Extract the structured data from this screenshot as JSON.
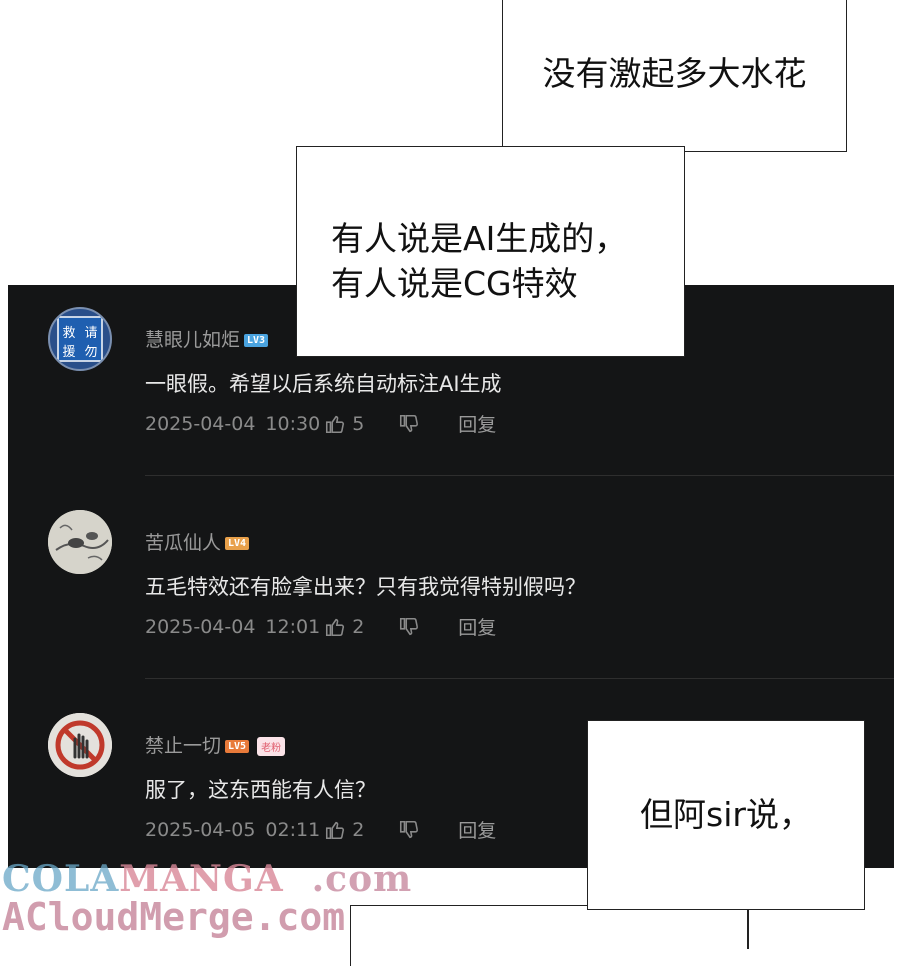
{
  "bubbles": {
    "top": "没有激起多大水花",
    "middle_line1": "有人说是AI生成的，",
    "middle_line2": "有人说是CG特效",
    "bottom": "但阿sir说，"
  },
  "comments": [
    {
      "username": "慧眼儿如炬",
      "level": "LV3",
      "level_color": "#4aa3df",
      "avatar_text": [
        "救",
        "请",
        "援",
        "勿"
      ],
      "text": "一眼假。希望以后系统自动标注AI生成",
      "date": "2025-04-04",
      "time": "10:30",
      "likes": "5",
      "reply": "回复"
    },
    {
      "username": "苦瓜仙人",
      "level": "LV4",
      "level_color": "#e8a04a",
      "text": "五毛特效还有脸拿出来？只有我觉得特别假吗？",
      "date": "2025-04-04",
      "time": "12:01",
      "likes": "2",
      "reply": "回复"
    },
    {
      "username": "禁止一切",
      "level": "LV5",
      "level_color": "#e87a3a",
      "tag": "老粉",
      "text": "服了，这东西能有人信？",
      "date": "2025-04-05",
      "time": "02:11",
      "likes": "2",
      "reply": "回复"
    }
  ],
  "watermark": {
    "part1": "COLA",
    "part2": "MANGA",
    "part3": ".com",
    "line2": "ACloudMerge.com"
  }
}
